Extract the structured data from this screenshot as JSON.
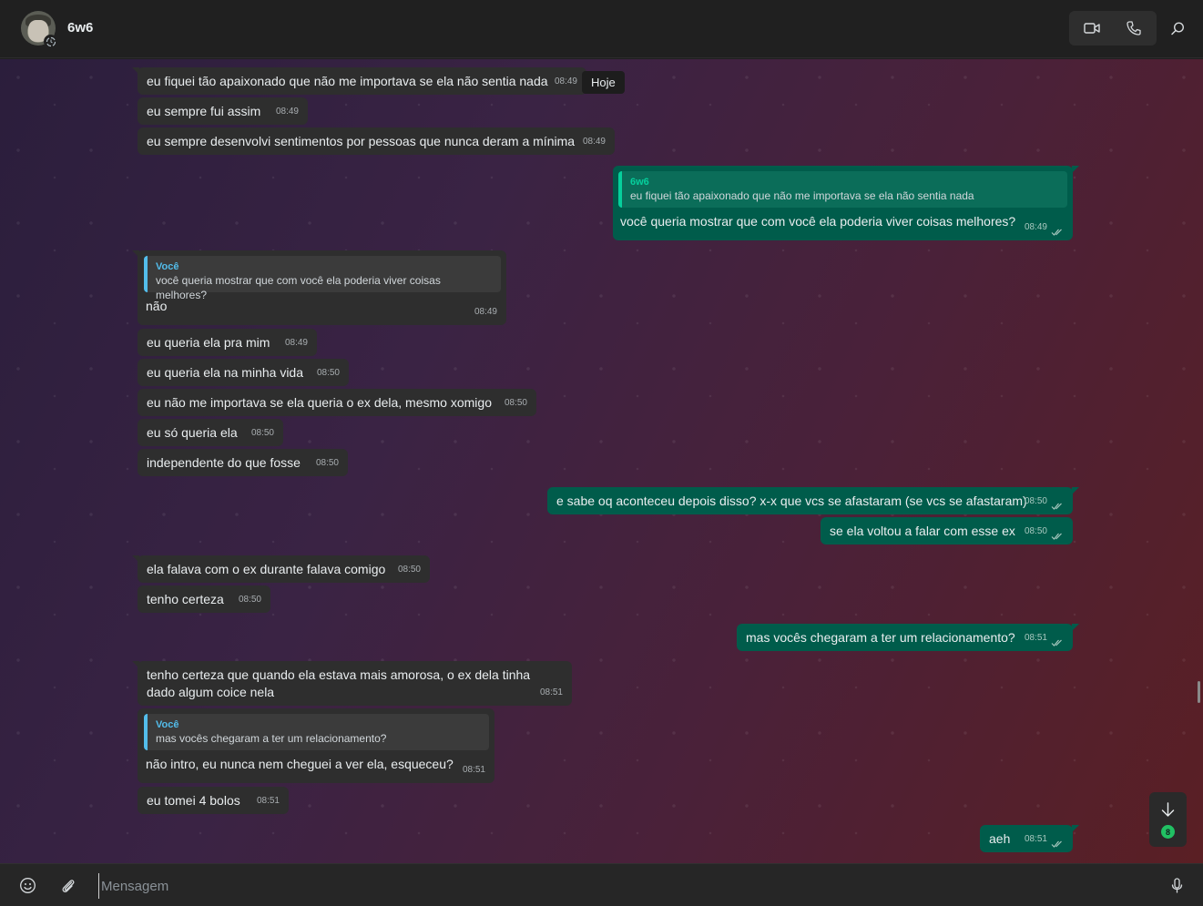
{
  "header": {
    "contact_name": "6w6"
  },
  "date_badge": "Hoje",
  "messages": [
    {
      "dir": "in",
      "text": "eu fiquei tão apaixonado que não me importava se ela não sentia nada",
      "time": "08:49"
    },
    {
      "dir": "in",
      "text": "eu sempre fui assim",
      "time": "08:49"
    },
    {
      "dir": "in",
      "text": "eu sempre desenvolvi sentimentos por pessoas que nunca deram a mínima",
      "time": "08:49"
    },
    {
      "dir": "out",
      "quote_name": "6w6",
      "quote_text": "eu fiquei tão apaixonado que não me importava se ela não sentia nada",
      "text": "você queria mostrar que com você ela poderia viver coisas melhores?",
      "time": "08:49"
    },
    {
      "dir": "in",
      "quote_name": "Você",
      "quote_text": "você queria mostrar que com você ela poderia viver coisas melhores?",
      "text": "não",
      "time": "08:49"
    },
    {
      "dir": "in",
      "text": "eu queria ela pra mim",
      "time": "08:49"
    },
    {
      "dir": "in",
      "text": "eu queria ela na minha vida",
      "time": "08:50"
    },
    {
      "dir": "in",
      "text": "eu não me importava se ela queria o ex dela, mesmo xomigo",
      "time": "08:50"
    },
    {
      "dir": "in",
      "text": "eu só queria ela",
      "time": "08:50"
    },
    {
      "dir": "in",
      "text": "independente do que fosse",
      "time": "08:50"
    },
    {
      "dir": "out",
      "text": "e sabe oq aconteceu depois disso? x-x que vcs se afastaram (se vcs se afastaram)",
      "time": "08:50"
    },
    {
      "dir": "out",
      "text": "se ela voltou a falar com esse ex",
      "time": "08:50"
    },
    {
      "dir": "in",
      "text": "ela falava com o ex durante falava comigo",
      "time": "08:50"
    },
    {
      "dir": "in",
      "text": "tenho certeza",
      "time": "08:50"
    },
    {
      "dir": "out",
      "text": "mas vocês chegaram a ter um relacionamento?",
      "time": "08:51"
    },
    {
      "dir": "in",
      "text": "tenho certeza que quando ela estava mais amorosa, o ex dela tinha dado algum coice nela",
      "time": "08:51"
    },
    {
      "dir": "in",
      "quote_name": "Você",
      "quote_text": "mas vocês chegaram a ter um relacionamento?",
      "text": "não intro, eu nunca nem cheguei a ver ela, esqueceu?",
      "time": "08:51"
    },
    {
      "dir": "in",
      "text": "eu tomei 4 bolos",
      "time": "08:51"
    },
    {
      "dir": "out",
      "text": "aeh",
      "time": "08:51"
    }
  ],
  "scroll_fab": {
    "unread": "8"
  },
  "composer": {
    "placeholder": "Mensagem"
  },
  "colors": {
    "incoming_bubble": "#2e2e2e",
    "outgoing_bubble": "#005c4b",
    "quote_accent_in": "#53bdeb",
    "quote_accent_out": "#06cf9c",
    "unread_badge": "#21c063"
  }
}
